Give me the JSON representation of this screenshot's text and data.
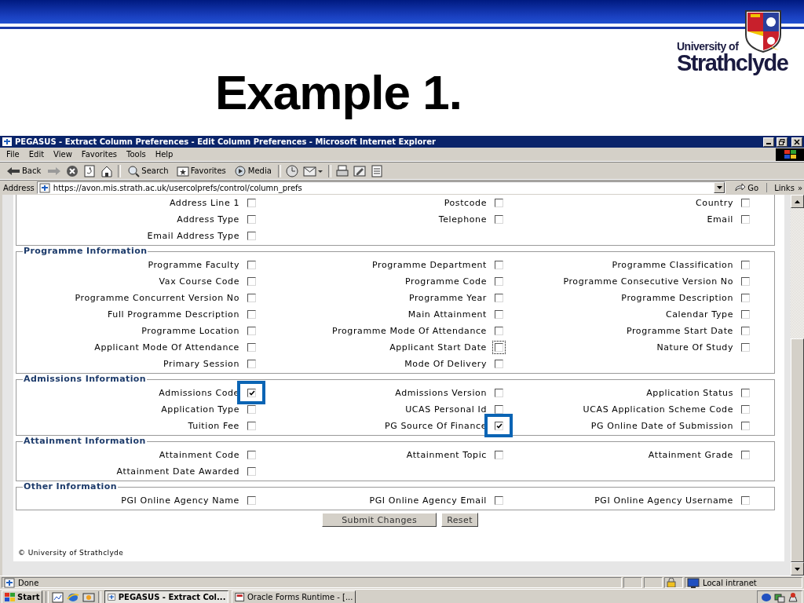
{
  "slide": {
    "title": "Example 1.",
    "logo_lines": [
      "University of",
      "Strathclyde"
    ]
  },
  "window": {
    "title": "PEGASUS - Extract Column Preferences - Edit Column Preferences - Microsoft Internet Explorer"
  },
  "menu": [
    "File",
    "Edit",
    "View",
    "Favorites",
    "Tools",
    "Help"
  ],
  "toolbar": [
    {
      "kind": "back",
      "label": "Back"
    },
    {
      "kind": "forward"
    },
    {
      "kind": "stop"
    },
    {
      "kind": "refresh"
    },
    {
      "kind": "home"
    },
    {
      "kind": "search",
      "label": "Search"
    },
    {
      "kind": "favorites",
      "label": "Favorites"
    },
    {
      "kind": "media",
      "label": "Media"
    },
    {
      "kind": "history"
    },
    {
      "kind": "mail"
    },
    {
      "kind": "print"
    },
    {
      "kind": "edit"
    },
    {
      "kind": "discuss"
    }
  ],
  "address_bar": {
    "label": "Address",
    "url": "https://avon.mis.strath.ac.uk/usercolprefs/control/column_prefs",
    "go": "Go",
    "links": "Links",
    "links_more": "»"
  },
  "sections": [
    {
      "rows": [
        [
          {
            "label": "Address Line 1",
            "checked": false,
            "focused": false,
            "highlighted": false
          },
          {
            "label": "Postcode",
            "checked": false,
            "focused": false,
            "highlighted": false
          },
          {
            "label": "Country",
            "checked": false,
            "focused": false,
            "highlighted": false
          }
        ],
        [
          {
            "label": "Address Type",
            "checked": false,
            "focused": false,
            "highlighted": false
          },
          {
            "label": "Telephone",
            "checked": false,
            "focused": false,
            "highlighted": false
          },
          {
            "label": "Email",
            "checked": false,
            "focused": false,
            "highlighted": false
          }
        ],
        [
          {
            "label": "Email Address Type",
            "checked": false,
            "focused": false,
            "highlighted": false
          }
        ]
      ]
    },
    {
      "legend": "Programme Information",
      "rows": [
        [
          {
            "label": "Programme Faculty",
            "checked": false,
            "focused": false,
            "highlighted": false
          },
          {
            "label": "Programme Department",
            "checked": false,
            "focused": false,
            "highlighted": false
          },
          {
            "label": "Programme Classification",
            "checked": false,
            "focused": false,
            "highlighted": false
          }
        ],
        [
          {
            "label": "Vax Course Code",
            "checked": false,
            "focused": false,
            "highlighted": false
          },
          {
            "label": "Programme Code",
            "checked": false,
            "focused": false,
            "highlighted": false
          },
          {
            "label": "Programme Consecutive Version No",
            "checked": false,
            "focused": false,
            "highlighted": false
          }
        ],
        [
          {
            "label": "Programme Concurrent Version No",
            "checked": false,
            "focused": false,
            "highlighted": false
          },
          {
            "label": "Programme Year",
            "checked": false,
            "focused": false,
            "highlighted": false
          },
          {
            "label": "Programme Description",
            "checked": false,
            "focused": false,
            "highlighted": false
          }
        ],
        [
          {
            "label": "Full Programme Description",
            "checked": false,
            "focused": false,
            "highlighted": false
          },
          {
            "label": "Main Attainment",
            "checked": false,
            "focused": false,
            "highlighted": false
          },
          {
            "label": "Calendar Type",
            "checked": false,
            "focused": false,
            "highlighted": false
          }
        ],
        [
          {
            "label": "Programme Location",
            "checked": false,
            "focused": false,
            "highlighted": false
          },
          {
            "label": "Programme Mode Of Attendance",
            "checked": false,
            "focused": false,
            "highlighted": false
          },
          {
            "label": "Programme Start Date",
            "checked": false,
            "focused": false,
            "highlighted": false
          }
        ],
        [
          {
            "label": "Applicant Mode Of Attendance",
            "checked": false,
            "focused": false,
            "highlighted": false
          },
          {
            "label": "Applicant Start Date",
            "checked": false,
            "focused": true,
            "highlighted": false
          },
          {
            "label": "Nature Of Study",
            "checked": false,
            "focused": false,
            "highlighted": false
          }
        ],
        [
          {
            "label": "Primary Session",
            "checked": false,
            "focused": false,
            "highlighted": false
          },
          {
            "label": "Mode Of Delivery",
            "checked": false,
            "focused": false,
            "highlighted": false
          }
        ]
      ]
    },
    {
      "legend": "Admissions Information",
      "rows": [
        [
          {
            "label": "Admissions Code",
            "checked": true,
            "focused": false,
            "highlighted": true
          },
          {
            "label": "Admissions Version",
            "checked": false,
            "focused": false,
            "highlighted": false
          },
          {
            "label": "Application Status",
            "checked": false,
            "focused": false,
            "highlighted": false
          }
        ],
        [
          {
            "label": "Application Type",
            "checked": false,
            "focused": false,
            "highlighted": false
          },
          {
            "label": "UCAS Personal Id",
            "checked": false,
            "focused": false,
            "highlighted": false
          },
          {
            "label": "UCAS Application Scheme Code",
            "checked": false,
            "focused": false,
            "highlighted": false
          }
        ],
        [
          {
            "label": "Tuition Fee",
            "checked": false,
            "focused": false,
            "highlighted": false
          },
          {
            "label": "PG Source Of Finance",
            "checked": true,
            "focused": false,
            "highlighted": true
          },
          {
            "label": "PG Online Date of Submission",
            "checked": false,
            "focused": false,
            "highlighted": false
          }
        ]
      ]
    },
    {
      "legend": "Attainment Information",
      "rows": [
        [
          {
            "label": "Attainment Code",
            "checked": false,
            "focused": false,
            "highlighted": false
          },
          {
            "label": "Attainment Topic",
            "checked": false,
            "focused": false,
            "highlighted": false
          },
          {
            "label": "Attainment Grade",
            "checked": false,
            "focused": false,
            "highlighted": false
          }
        ],
        [
          {
            "label": "Attainment Date Awarded",
            "checked": false,
            "focused": false,
            "highlighted": false
          }
        ]
      ]
    },
    {
      "legend": "Other Information",
      "rows": [
        [
          {
            "label": "PGI Online Agency Name",
            "checked": false,
            "focused": false,
            "highlighted": false
          },
          {
            "label": "PGI Online Agency Email",
            "checked": false,
            "focused": false,
            "highlighted": false
          },
          {
            "label": "PGI Online Agency Username",
            "checked": false,
            "focused": false,
            "highlighted": false
          }
        ]
      ]
    }
  ],
  "buttons": [
    "Submit Changes",
    "Reset"
  ],
  "footer": "© University of Strathclyde",
  "status_bar": {
    "text": "Done",
    "zone": "Local intranet"
  },
  "taskbar": {
    "start": "Start",
    "tasks": [
      {
        "label": "PEGASUS - Extract Col...",
        "selected": true
      },
      {
        "label": "Oracle Forms Runtime - [...",
        "selected": false
      }
    ]
  }
}
